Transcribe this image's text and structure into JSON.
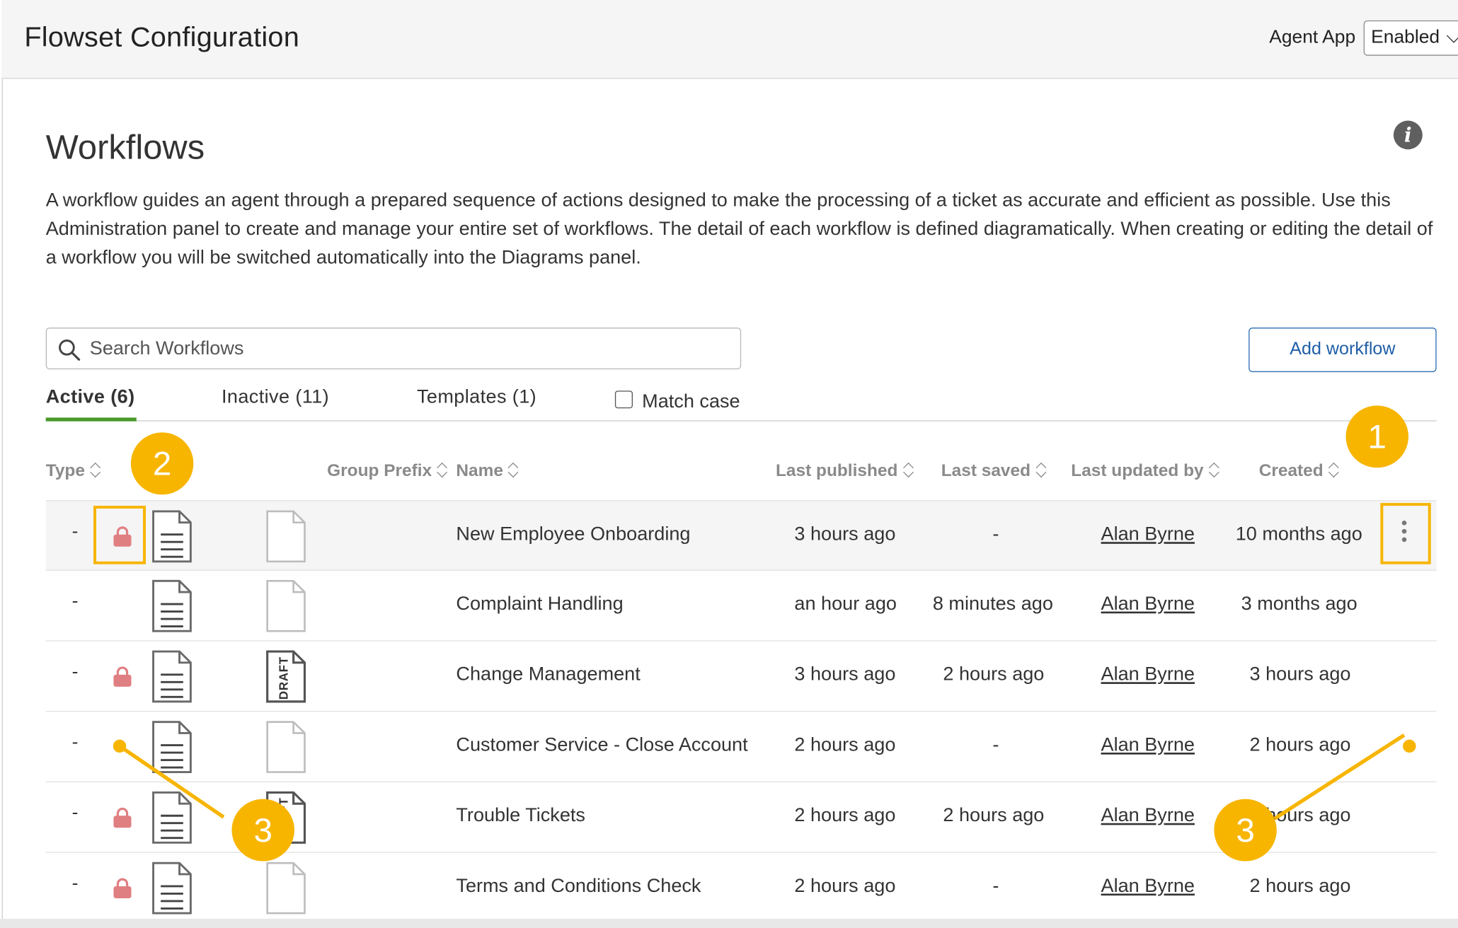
{
  "header": {
    "app_title": "Flowset Configuration",
    "agent_app_label": "Agent App",
    "agent_app_value": "Enabled"
  },
  "page": {
    "title": "Workflows",
    "info_icon": "info-icon",
    "description": "A workflow guides an agent through a prepared sequence of actions designed to make the processing of a ticket as accurate and efficient as possible. Use this Administration panel to create and manage your entire set of workflows. The detail of each workflow is defined diagramatically. When creating or editing the detail of a workflow you will be switched automatically into the Diagrams panel."
  },
  "search": {
    "placeholder": "Search Workflows",
    "value": ""
  },
  "actions": {
    "add_label": "Add workflow"
  },
  "tabs": [
    {
      "label": "Active (6)",
      "active": true
    },
    {
      "label": "Inactive (11)",
      "active": false
    },
    {
      "label": "Templates (1)",
      "active": false
    }
  ],
  "match_case": {
    "label": "Match case",
    "checked": false
  },
  "columns": {
    "type": "Type",
    "group_prefix": "Group Prefix",
    "name": "Name",
    "last_published": "Last published",
    "last_saved": "Last saved",
    "last_updated_by": "Last updated by",
    "created": "Created"
  },
  "rows": [
    {
      "type": "-",
      "locked": true,
      "draft": false,
      "name": "New Employee Onboarding",
      "last_published": "3 hours ago",
      "last_saved": "-",
      "updated_by": "Alan Byrne",
      "created": "10 months ago"
    },
    {
      "type": "-",
      "locked": false,
      "draft": false,
      "name": "Complaint Handling",
      "last_published": "an hour ago",
      "last_saved": "8 minutes ago",
      "updated_by": "Alan Byrne",
      "created": "3 months ago"
    },
    {
      "type": "-",
      "locked": true,
      "draft": true,
      "name": "Change Management",
      "last_published": "3 hours ago",
      "last_saved": "2 hours ago",
      "updated_by": "Alan Byrne",
      "created": "3 hours ago"
    },
    {
      "type": "-",
      "locked": false,
      "draft": false,
      "name": "Customer Service - Close Account",
      "last_published": "2 hours ago",
      "last_saved": "-",
      "updated_by": "Alan Byrne",
      "created": "2 hours ago"
    },
    {
      "type": "-",
      "locked": true,
      "draft": true,
      "name": "Trouble Tickets",
      "last_published": "2 hours ago",
      "last_saved": "2 hours ago",
      "updated_by": "Alan Byrne",
      "created": "2 hours ago"
    },
    {
      "type": "-",
      "locked": true,
      "draft": false,
      "name": "Terms and Conditions Check",
      "last_published": "2 hours ago",
      "last_saved": "-",
      "updated_by": "Alan Byrne",
      "created": "2 hours ago"
    }
  ],
  "draft_stamp": "DRAFT",
  "annotations": {
    "badge_1": "1",
    "badge_2": "2",
    "badge_3": "3",
    "color": "#f7b500"
  },
  "colors": {
    "lock": "#e07f82",
    "tab_active_underline": "#4a9a2c",
    "button_border": "#2c6db5"
  }
}
